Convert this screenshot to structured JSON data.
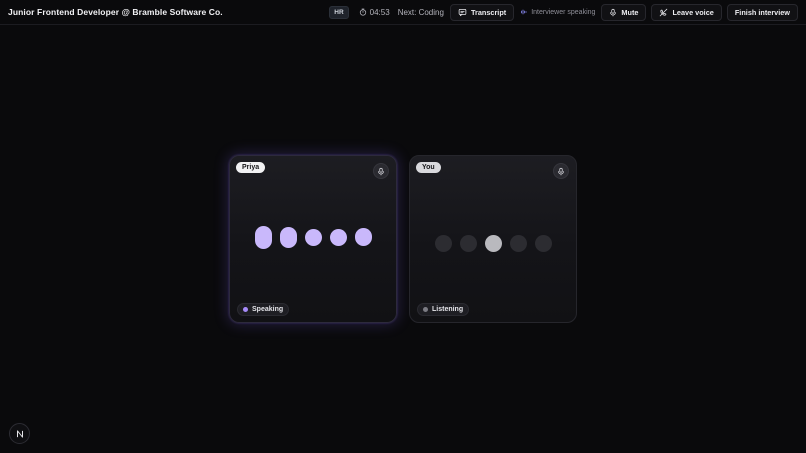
{
  "header": {
    "title": "Junior Frontend Developer @ Bramble Software Co.",
    "badge": "HR",
    "timer": "04:53",
    "next": "Next: Coding",
    "transcript_label": "Transcript",
    "interviewer_status": "Interviewer speaking",
    "mute_label": "Mute",
    "leave_label": "Leave voice",
    "finish_label": "Finish interview"
  },
  "participants": [
    {
      "name": "Priya",
      "state": "Speaking",
      "state_color": "#a78bfa"
    },
    {
      "name": "You",
      "state": "Listening",
      "state_color": "#7c7c84"
    }
  ],
  "colors": {
    "accent": "#c9b8fb",
    "background": "#0a0a0c"
  },
  "icons": {
    "timer": "timer-icon",
    "transcript": "transcript-icon",
    "wave": "sound-wave-icon",
    "mic": "microphone-icon",
    "leave": "phone-off-icon",
    "fab": "n-logo-icon"
  }
}
